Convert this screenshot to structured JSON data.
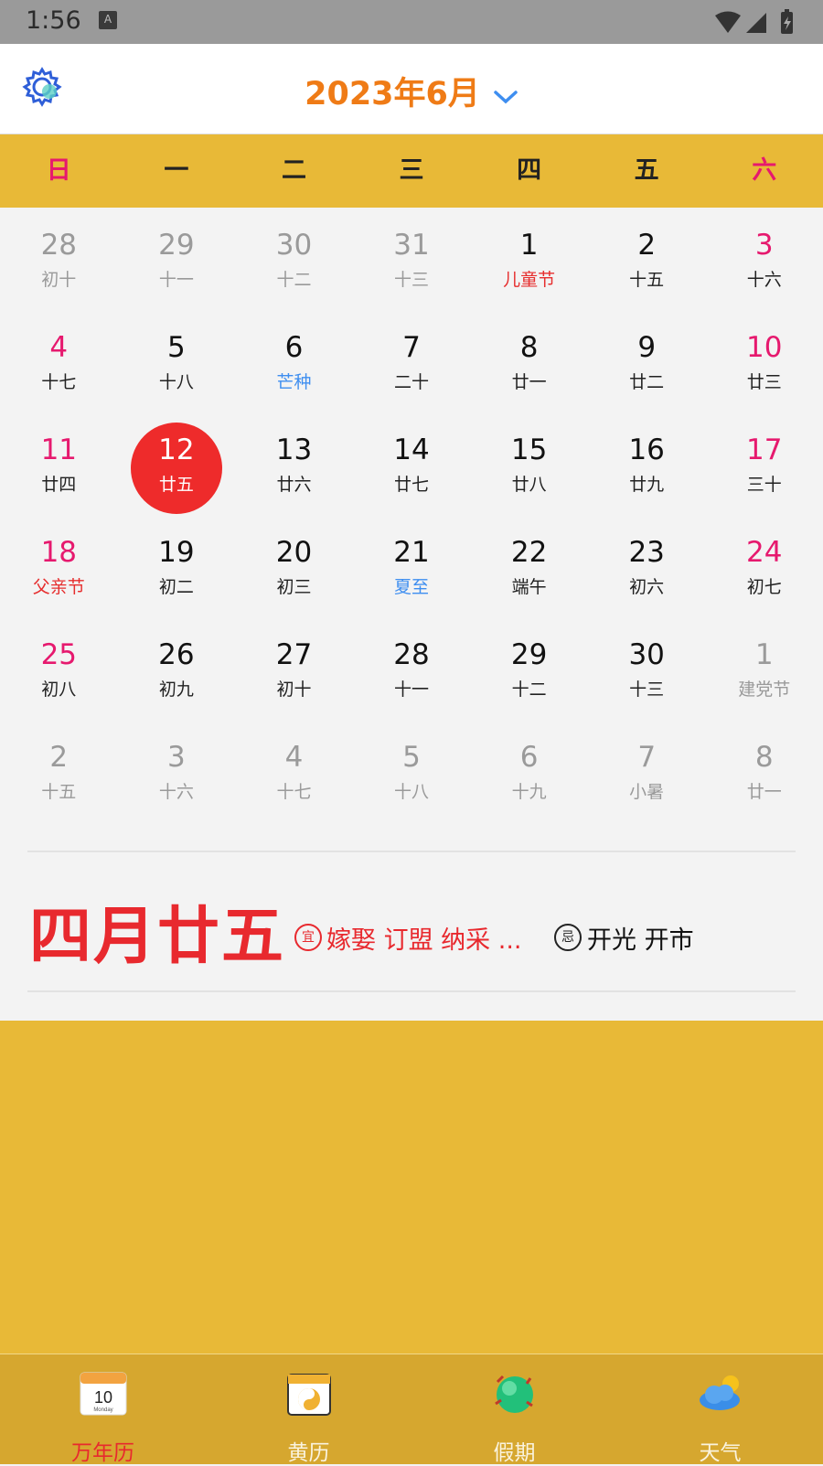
{
  "status_bar": {
    "time": "1:56",
    "notification_icon": "A"
  },
  "header": {
    "title": "2023年6月"
  },
  "weekdays": [
    "日",
    "一",
    "二",
    "三",
    "四",
    "五",
    "六"
  ],
  "calendar": [
    [
      {
        "d": "28",
        "l": "初十",
        "other": true
      },
      {
        "d": "29",
        "l": "十一",
        "other": true
      },
      {
        "d": "30",
        "l": "十二",
        "other": true
      },
      {
        "d": "31",
        "l": "十三",
        "other": true
      },
      {
        "d": "1",
        "l": "儿童节",
        "fest": true
      },
      {
        "d": "2",
        "l": "十五"
      },
      {
        "d": "3",
        "l": "十六",
        "wk": true
      }
    ],
    [
      {
        "d": "4",
        "l": "十七",
        "wk": true
      },
      {
        "d": "5",
        "l": "十八"
      },
      {
        "d": "6",
        "l": "芒种",
        "term": true
      },
      {
        "d": "7",
        "l": "二十"
      },
      {
        "d": "8",
        "l": "廿一"
      },
      {
        "d": "9",
        "l": "廿二"
      },
      {
        "d": "10",
        "l": "廿三",
        "wk": true
      }
    ],
    [
      {
        "d": "11",
        "l": "廿四",
        "wk": true
      },
      {
        "d": "12",
        "l": "廿五",
        "today": true
      },
      {
        "d": "13",
        "l": "廿六"
      },
      {
        "d": "14",
        "l": "廿七"
      },
      {
        "d": "15",
        "l": "廿八"
      },
      {
        "d": "16",
        "l": "廿九"
      },
      {
        "d": "17",
        "l": "三十",
        "wk": true
      }
    ],
    [
      {
        "d": "18",
        "l": "父亲节",
        "wk": true,
        "fest": true
      },
      {
        "d": "19",
        "l": "初二"
      },
      {
        "d": "20",
        "l": "初三"
      },
      {
        "d": "21",
        "l": "夏至",
        "term": true
      },
      {
        "d": "22",
        "l": "端午"
      },
      {
        "d": "23",
        "l": "初六"
      },
      {
        "d": "24",
        "l": "初七",
        "wk": true
      }
    ],
    [
      {
        "d": "25",
        "l": "初八",
        "wk": true
      },
      {
        "d": "26",
        "l": "初九"
      },
      {
        "d": "27",
        "l": "初十"
      },
      {
        "d": "28",
        "l": "十一"
      },
      {
        "d": "29",
        "l": "十二"
      },
      {
        "d": "30",
        "l": "十三"
      },
      {
        "d": "1",
        "l": "建党节",
        "other": true
      }
    ],
    [
      {
        "d": "2",
        "l": "十五",
        "other": true
      },
      {
        "d": "3",
        "l": "十六",
        "other": true
      },
      {
        "d": "4",
        "l": "十七",
        "other": true
      },
      {
        "d": "5",
        "l": "十八",
        "other": true
      },
      {
        "d": "6",
        "l": "十九",
        "other": true
      },
      {
        "d": "7",
        "l": "小暑",
        "other": true
      },
      {
        "d": "8",
        "l": "廿一",
        "other": true
      }
    ]
  ],
  "day_detail": {
    "lunar_date": "四月廿五",
    "yi_badge": "宜",
    "yi_text": "嫁娶 订盟 纳采 ...",
    "ji_badge": "忌",
    "ji_text": "开光 开市"
  },
  "tabs": [
    {
      "label": "万年历",
      "icon": "desk-calendar-icon",
      "active": true,
      "icon_text": "10",
      "icon_sub": "Monday"
    },
    {
      "label": "黄历",
      "icon": "yin-yang-calendar-icon"
    },
    {
      "label": "假期",
      "icon": "globe-icon"
    },
    {
      "label": "天气",
      "icon": "weather-cloud-icon"
    }
  ],
  "colors": {
    "accent_orange": "#ef7b16",
    "weekend_pink": "#e6196e",
    "today_red": "#ee2b2b",
    "festival_red": "#e62e2e",
    "solar_term_blue": "#3e8ef0",
    "panel_yellow": "#e8b937"
  }
}
